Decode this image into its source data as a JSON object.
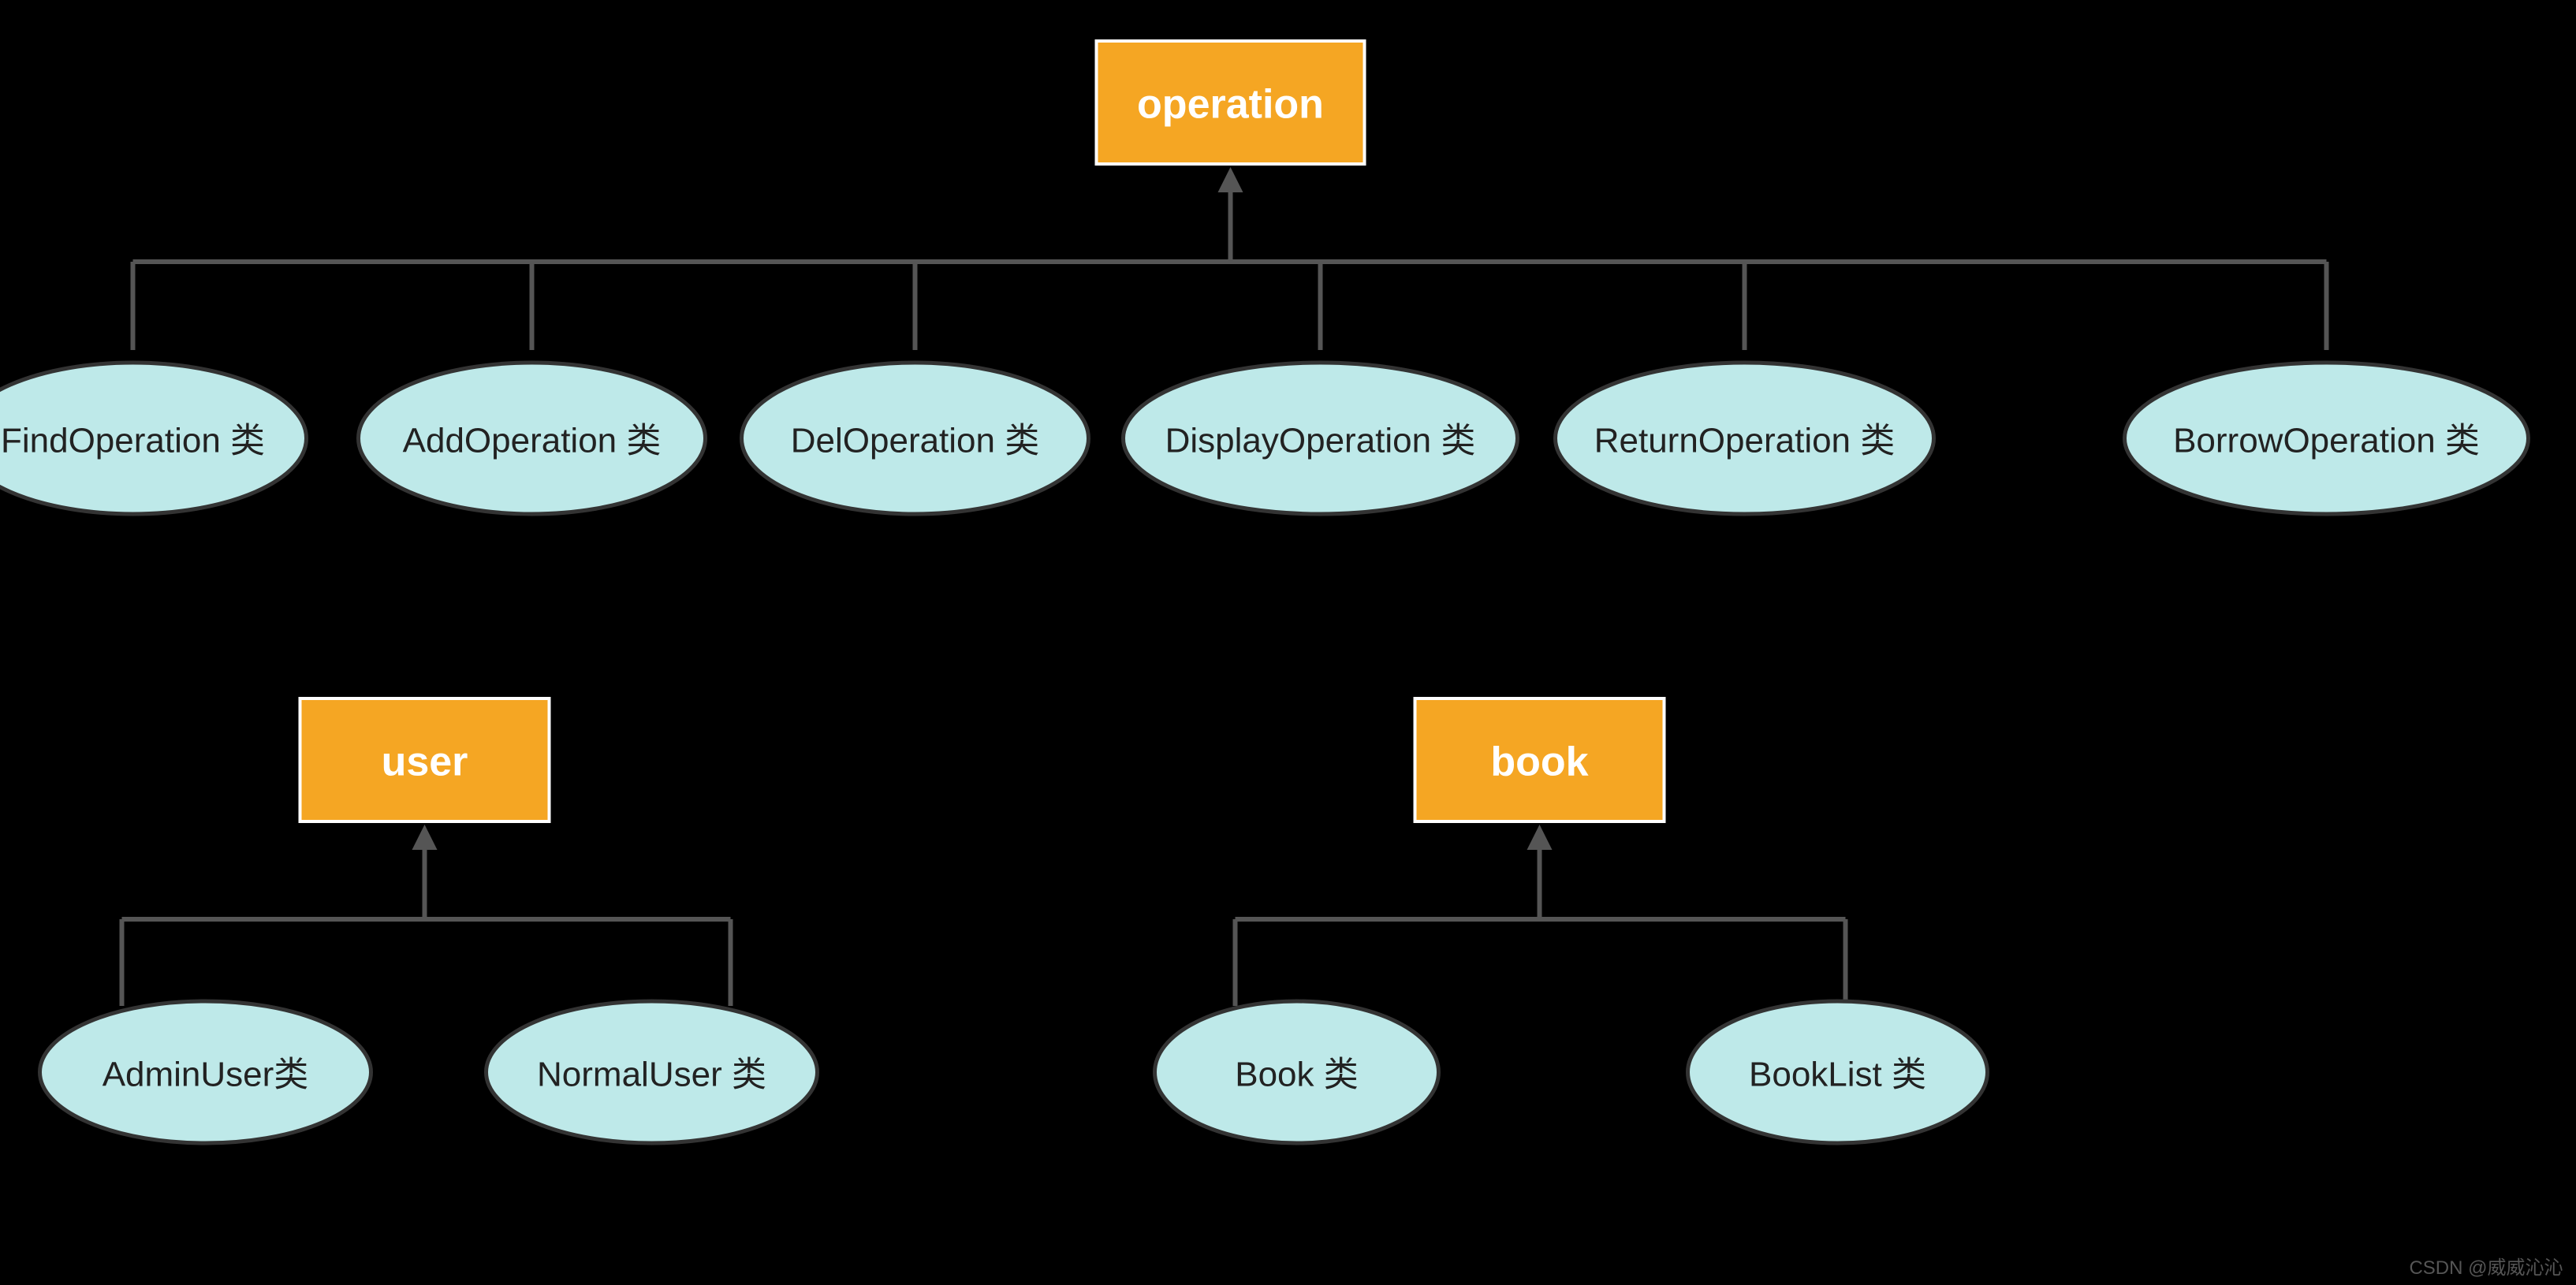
{
  "watermark": "CSDN @威威沁沁",
  "packages": {
    "operation": {
      "label": "operation",
      "classes": [
        "FindOperation 类",
        "AddOperation 类",
        "DelOperation 类",
        "DisplayOperation 类",
        "ReturnOperation 类",
        "BorrowOperation 类"
      ]
    },
    "user": {
      "label": "user",
      "classes": [
        "AdminUser类",
        "NormalUser 类"
      ]
    },
    "book": {
      "label": "book",
      "classes": [
        "Book 类",
        "BookList 类"
      ]
    }
  }
}
